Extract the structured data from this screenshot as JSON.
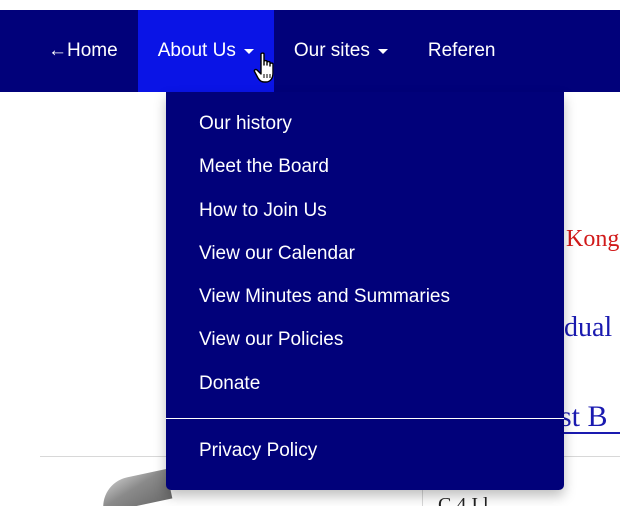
{
  "navbar": {
    "items": [
      {
        "label": "←Home",
        "has_caret": false
      },
      {
        "label": "About Us",
        "has_caret": true,
        "active": true
      },
      {
        "label": "Our sites",
        "has_caret": true
      },
      {
        "label": "Referen",
        "has_caret": false
      }
    ]
  },
  "dropdown": {
    "items": [
      {
        "label": "Our history"
      },
      {
        "label": "Meet the Board"
      },
      {
        "label": "How to Join Us"
      },
      {
        "label": "View our Calendar"
      },
      {
        "label": "View Minutes and Summaries"
      },
      {
        "label": "View our Policies"
      },
      {
        "label": "Donate"
      }
    ],
    "after_divider": [
      {
        "label": "Privacy Policy"
      }
    ]
  },
  "background": {
    "red_fragment": "Kong",
    "blue_fragment_1": "dual",
    "blue_fragment_2": "st B",
    "bottom_fragment": "C    4 I   l"
  },
  "colors": {
    "navbar_bg": "#01017a",
    "active_bg": "#0a14e6",
    "text": "#ffffff"
  },
  "icons": {
    "cursor": "hand-pointer-icon",
    "caret": "caret-down-icon"
  }
}
